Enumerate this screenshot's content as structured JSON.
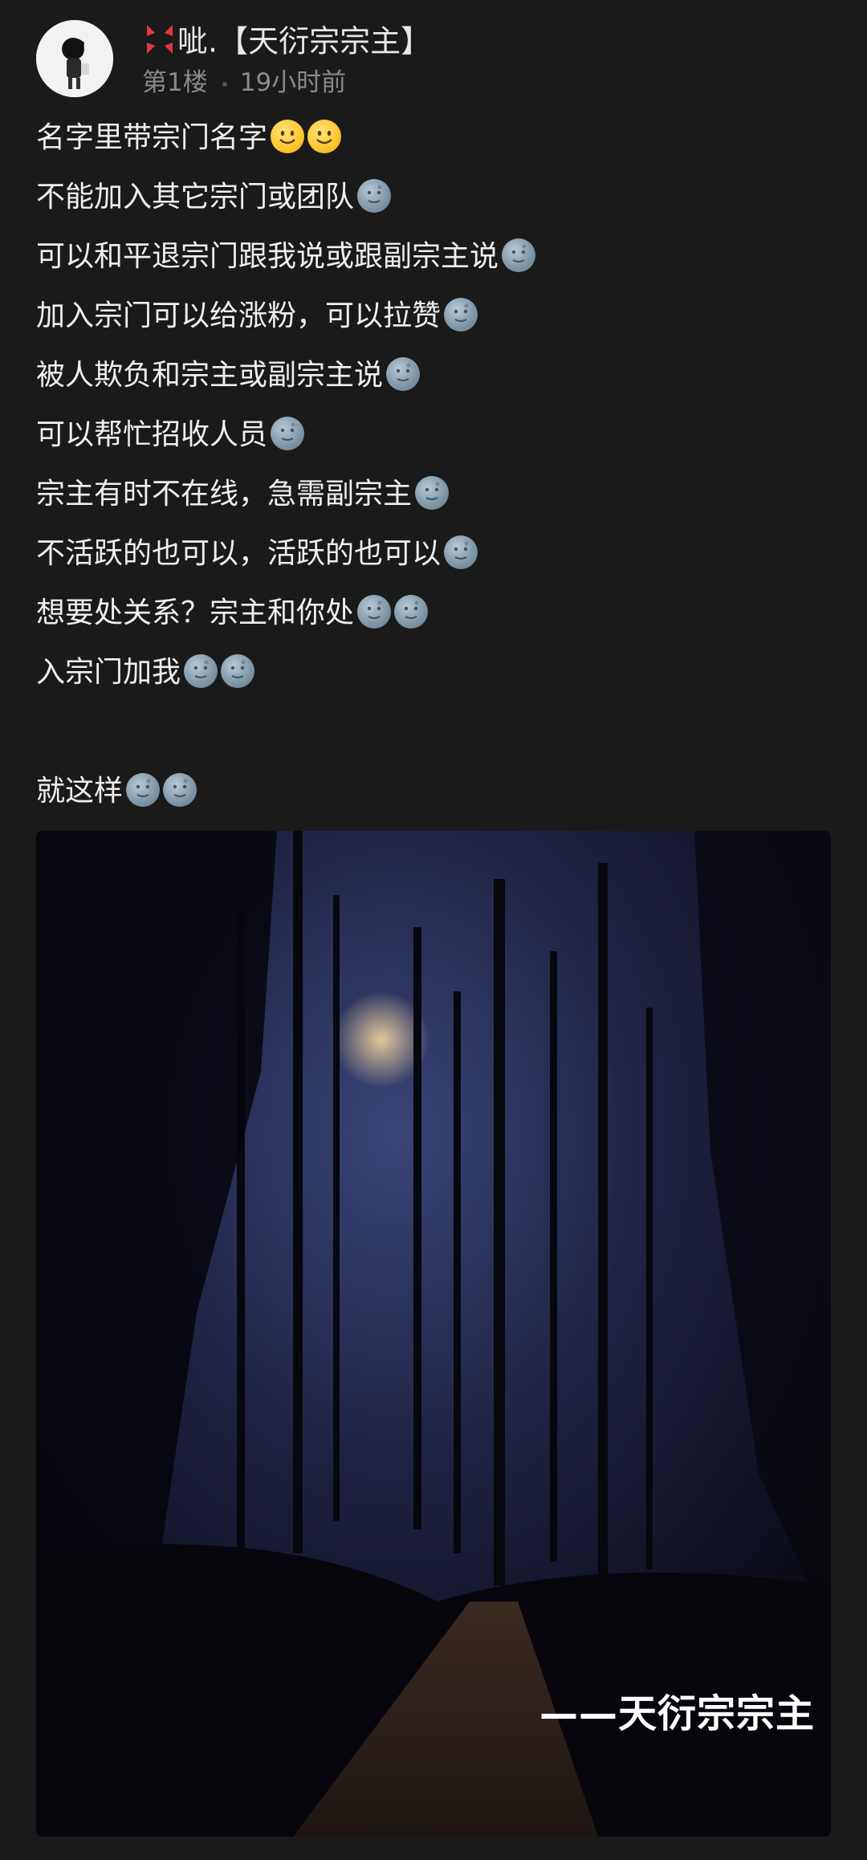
{
  "post": {
    "author": {
      "name": "呲.【天衍宗宗主】",
      "flair_icons": [
        "angry-vein-icon",
        "cigarette-icon"
      ]
    },
    "floor": "第1楼",
    "time": "19小时前",
    "lines": [
      {
        "text": "名字里带宗门名字",
        "emojis": [
          "smile",
          "smile"
        ]
      },
      {
        "text": "不能加入其它宗门或团队",
        "emojis": [
          "moon"
        ]
      },
      {
        "text": "可以和平退宗门跟我说或跟副宗主说",
        "emojis": [
          "moon"
        ]
      },
      {
        "text": "加入宗门可以给涨粉，可以拉赞",
        "emojis": [
          "moon"
        ]
      },
      {
        "text": "被人欺负和宗主或副宗主说",
        "emojis": [
          "moon"
        ]
      },
      {
        "text": "可以帮忙招收人员",
        "emojis": [
          "moon"
        ]
      },
      {
        "text": "宗主有时不在线，急需副宗主",
        "emojis": [
          "moon"
        ]
      },
      {
        "text": "不活跃的也可以，活跃的也可以",
        "emojis": [
          "moon"
        ]
      },
      {
        "text": "想要处关系？宗主和你处",
        "emojis": [
          "moon",
          "moon"
        ]
      },
      {
        "text": "入宗门加我",
        "emojis": [
          "moon",
          "moon"
        ]
      },
      {
        "text": "",
        "emojis": []
      },
      {
        "text": "就这样",
        "emojis": [
          "moon",
          "moon"
        ]
      }
    ],
    "image": {
      "watermark": "——天衍宗宗主"
    }
  }
}
